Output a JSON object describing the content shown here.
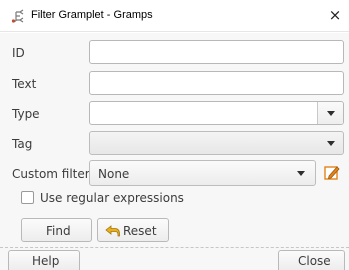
{
  "window": {
    "title": "Filter Gramplet - Gramps",
    "app_icon": "gramps-tree-icon",
    "close_glyph": "×"
  },
  "labels": {
    "id": "ID",
    "text": "Text",
    "type": "Type",
    "tag": "Tag",
    "custom_filter": "Custom filter"
  },
  "fields": {
    "id_value": "",
    "text_value": "",
    "type_value": "",
    "tag_value": "",
    "custom_filter_value": "None"
  },
  "options": {
    "use_regex_label": "Use regular expressions",
    "use_regex_checked": false
  },
  "buttons": {
    "find": "Find",
    "reset": "Reset",
    "reset_icon": "undo-arrow-icon",
    "edit_icon": "pencil-edit-icon",
    "help": "Help",
    "close": "Close"
  },
  "colors": {
    "edit_icon_orange": "#e2841a",
    "reset_arrow_yellow": "#e9b21b"
  }
}
